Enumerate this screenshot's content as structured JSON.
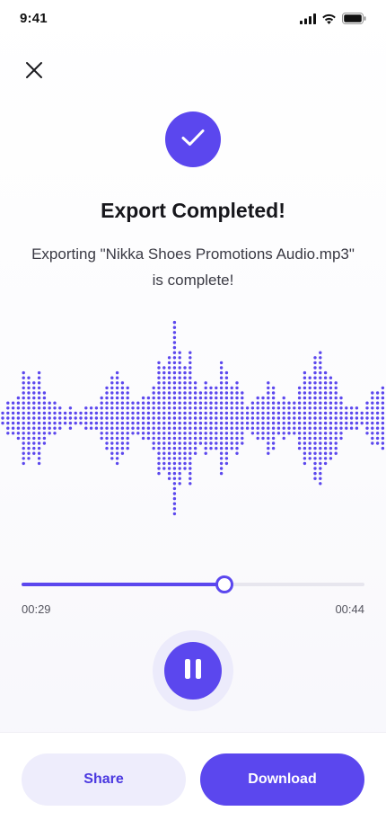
{
  "status_bar": {
    "time": "9:41",
    "icons": [
      "cellular-signal-icon",
      "wifi-icon",
      "battery-icon"
    ]
  },
  "close_icon": "close-icon",
  "check_icon": "checkmark-icon",
  "title": "Export Completed!",
  "message": {
    "line1": "Exporting \"Nikka Shoes Promotions Audio.mp3\"",
    "line2": "is complete!"
  },
  "player": {
    "current_time": "00:29",
    "total_time": "00:44",
    "progress": 0.59,
    "pause_icon": "pause-icon"
  },
  "actions": {
    "share_label": "Share",
    "download_label": "Download"
  },
  "colors": {
    "accent": "#5b47ee",
    "accent_light": "#eeedfc",
    "text": "#17171c"
  }
}
